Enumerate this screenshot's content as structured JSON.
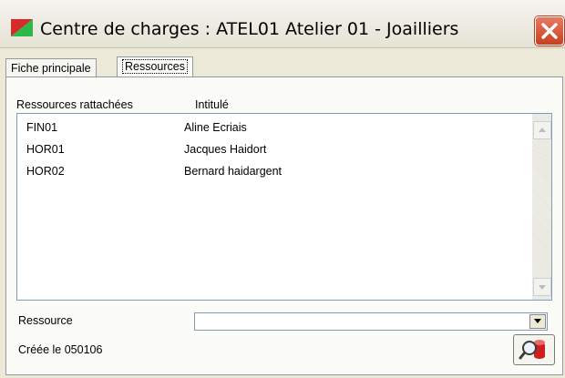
{
  "window": {
    "title": "Centre de charges : ATEL01 Atelier 01 - Joailliers",
    "icon": "app-icon",
    "close_icon": "close-icon"
  },
  "tabs": [
    {
      "label": "Fiche principale"
    },
    {
      "label": "Ressources"
    }
  ],
  "list": {
    "headers": [
      "Ressources rattachées",
      "Intitulé"
    ],
    "rows": [
      {
        "code": "FIN01",
        "name": "Aline Ecriais"
      },
      {
        "code": "HOR01",
        "name": "Jacques Haidort"
      },
      {
        "code": "HOR02",
        "name": "Bernard haidargent"
      }
    ]
  },
  "ressource": {
    "label": "Ressource",
    "value": ""
  },
  "footer": {
    "created": "Créée le 050106",
    "tool_icon": "search-database-icon"
  },
  "colors": {
    "close": "#d4532f",
    "border": "#919b9c",
    "field_border": "#7f9db9"
  }
}
